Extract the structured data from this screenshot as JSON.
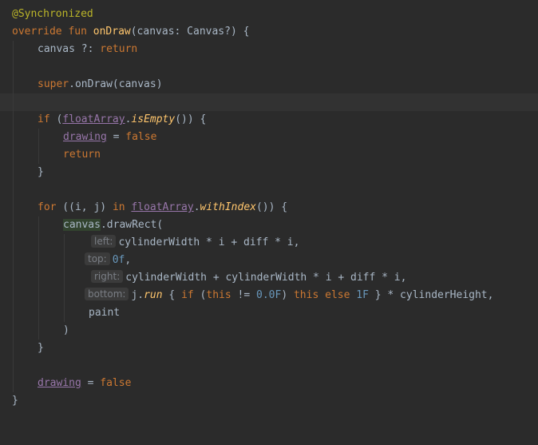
{
  "editor": {
    "background": "#2b2b2b",
    "current_line_background": "#323232",
    "colors": {
      "annotation": "#bbb529",
      "keyword": "#cc7832",
      "function": "#ffc66d",
      "number": "#6897bb",
      "property": "#9876aa",
      "text": "#a9b7c6",
      "hint": "#7a7e85"
    }
  },
  "code": {
    "l1_annotation": "@Synchronized",
    "l2_override": "override",
    "l2_fun": "fun",
    "l2_name": "onDraw",
    "l2_params": "(canvas: Canvas?) {",
    "l3_canvas": "canvas",
    "l3_elvis": " ?: ",
    "l3_return": "return",
    "l5_super": "super",
    "l5_call": ".onDraw(canvas)",
    "l7_if": "if",
    "l7_paren": " (",
    "l7_floatArray": "floatArray",
    "l7_dot": ".",
    "l7_isEmpty": "isEmpty",
    "l7_tail": "()) {",
    "l8_drawing": "drawing",
    "l8_eq": " = ",
    "l8_false": "false",
    "l9_return": "return",
    "l10_brace": "}",
    "l12_for": "for",
    "l12_vars": " ((i, j) ",
    "l12_in": "in",
    "l12_space": " ",
    "l12_floatArray": "floatArray",
    "l12_dot": ".",
    "l12_withIndex": "withIndex",
    "l12_tail": "()) {",
    "l13_canvas": "canvas",
    "l13_call": ".drawRect(",
    "l14_hint": "left:",
    "l14_code": "cylinderWidth * i + diff * i,",
    "l15_hint": "top:",
    "l15_num": "0f",
    "l15_comma": ",",
    "l16_hint": "right:",
    "l16_code": "cylinderWidth + cylinderWidth * i + diff * i,",
    "l17_hint": "bottom:",
    "l17_j": "j.",
    "l17_run": "run",
    "l17_open": " { ",
    "l17_if": "if",
    "l17_paren": " (",
    "l17_this1": "this",
    "l17_ne": " != ",
    "l17_num1": "0.0F",
    "l17_close": ") ",
    "l17_this2": "this",
    "l17_sp": " ",
    "l17_else": "else",
    "l17_sp2": " ",
    "l17_num2": "1F",
    "l17_tail": " } * cylinderHeight,",
    "l18_paint": "paint",
    "l19_paren": ")",
    "l20_brace": "}",
    "l22_drawing": "drawing",
    "l22_eq": " = ",
    "l22_false": "false",
    "l23_brace": "}"
  }
}
